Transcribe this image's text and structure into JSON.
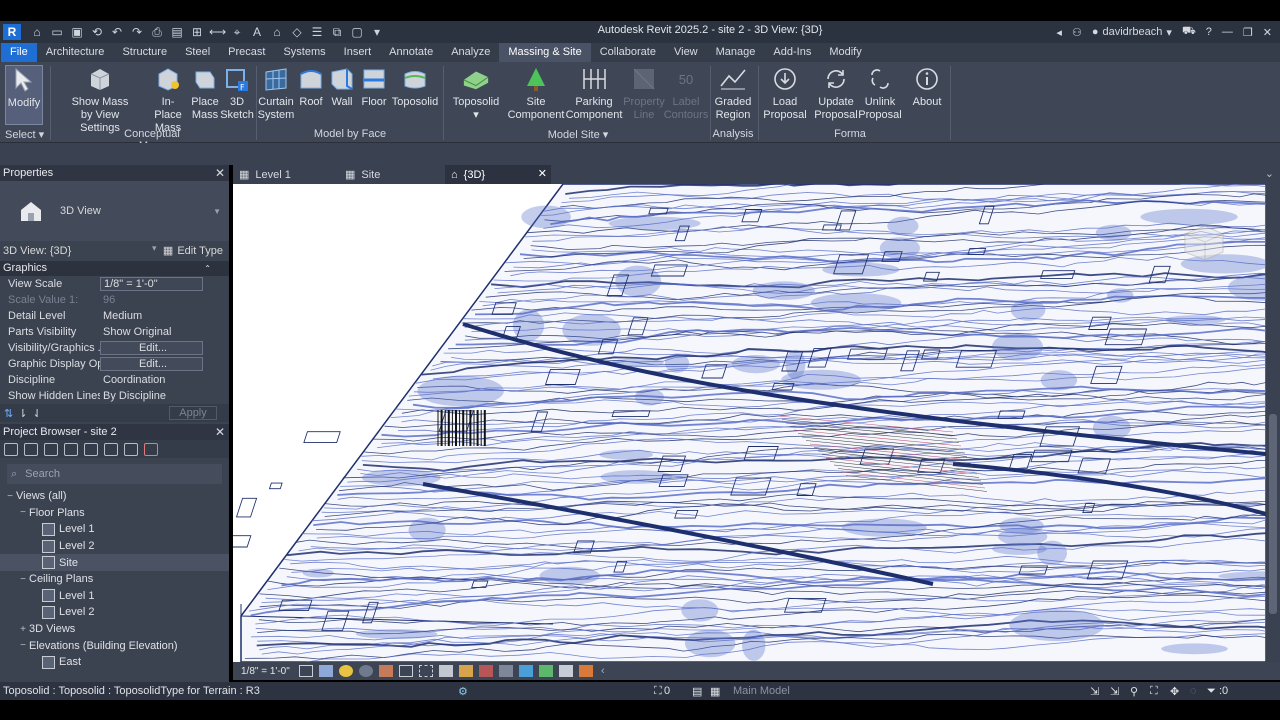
{
  "titlebar": {
    "app_badge": "R",
    "title": "Autodesk Revit 2025.2 - site 2 - 3D View: {3D}",
    "user": "davidrbeach"
  },
  "tabs": [
    "File",
    "Architecture",
    "Structure",
    "Steel",
    "Precast",
    "Systems",
    "Insert",
    "Annotate",
    "Analyze",
    "Massing & Site",
    "Collaborate",
    "View",
    "Manage",
    "Add-Ins",
    "Modify"
  ],
  "active_tab": "Massing & Site",
  "ribbon": {
    "modify": "Modify",
    "select": "Select",
    "show_mass": "Show Mass",
    "by_view_settings": "by View Settings",
    "in_place_mass": [
      "In-Place",
      "Mass"
    ],
    "place_mass": [
      "Place",
      "Mass"
    ],
    "sketch_3d": [
      "3D",
      "Sketch"
    ],
    "conceptual_mass": "Conceptual Mass",
    "curtain_system": [
      "Curtain",
      "System"
    ],
    "roof": "Roof",
    "wall": "Wall",
    "floor": "Floor",
    "toposolid_face": "Toposolid",
    "model_by_face": "Model by Face",
    "toposolid": "Toposolid",
    "site_component": [
      "Site",
      "Component"
    ],
    "parking_component": [
      "Parking",
      "Component"
    ],
    "property_line": [
      "Property",
      "Line"
    ],
    "label_contours": [
      "Label",
      "Contours"
    ],
    "label_contours_value": "50",
    "model_site": "Model Site",
    "graded_region": [
      "Graded",
      "Region"
    ],
    "analysis": "Analysis",
    "load_proposal": [
      "Load",
      "Proposal"
    ],
    "update_proposal": [
      "Update",
      "Proposal"
    ],
    "unlink_proposal": [
      "Unlink",
      "Proposal"
    ],
    "about": "About",
    "forma": "Forma"
  },
  "properties": {
    "title": "Properties",
    "type_name": "3D View",
    "view_selector": "3D View: {3D}",
    "edit_type": "Edit Type",
    "section": "Graphics",
    "rows": [
      {
        "k": "View Scale",
        "v": "1/8\" = 1'-0\""
      },
      {
        "k": "Scale Value    1:",
        "v": "96"
      },
      {
        "k": "Detail Level",
        "v": "Medium"
      },
      {
        "k": "Parts Visibility",
        "v": "Show Original"
      },
      {
        "k": "Visibility/Graphics ...",
        "v": "Edit..."
      },
      {
        "k": "Graphic Display Op...",
        "v": "Edit..."
      },
      {
        "k": "Discipline",
        "v": "Coordination"
      },
      {
        "k": "Show Hidden Lines",
        "v": "By Discipline"
      }
    ],
    "apply": "Apply"
  },
  "project_browser": {
    "title": "Project Browser - site 2",
    "search_placeholder": "Search",
    "tree": [
      {
        "label": "Views (all)",
        "level": 0,
        "toggle": "−"
      },
      {
        "label": "Floor Plans",
        "level": 1,
        "toggle": "−"
      },
      {
        "label": "Level 1",
        "level": 2,
        "toggle": ""
      },
      {
        "label": "Level 2",
        "level": 2,
        "toggle": ""
      },
      {
        "label": "Site",
        "level": 2,
        "toggle": ""
      },
      {
        "label": "Ceiling Plans",
        "level": 1,
        "toggle": "−"
      },
      {
        "label": "Level 1",
        "level": 2,
        "toggle": ""
      },
      {
        "label": "Level 2",
        "level": 2,
        "toggle": ""
      },
      {
        "label": "3D Views",
        "level": 1,
        "toggle": "+"
      },
      {
        "label": "Elevations (Building Elevation)",
        "level": 1,
        "toggle": "−"
      },
      {
        "label": "East",
        "level": 2,
        "toggle": ""
      }
    ]
  },
  "view_tabs": [
    "Level 1",
    "Site",
    "{3D}"
  ],
  "viewbar": {
    "scale": "1/8\" = 1'-0\""
  },
  "status": {
    "text": "Toposolid : Toposolid : ToposolidType for Terrain : R3",
    "selection_count": "0",
    "workset_count": ":0",
    "model": "Main Model",
    "filter_count": ":0"
  },
  "colors": {
    "accent": "#1f6ed4",
    "contour_dark": "#1e2f6e",
    "contour_light": "#5a6fc9"
  }
}
